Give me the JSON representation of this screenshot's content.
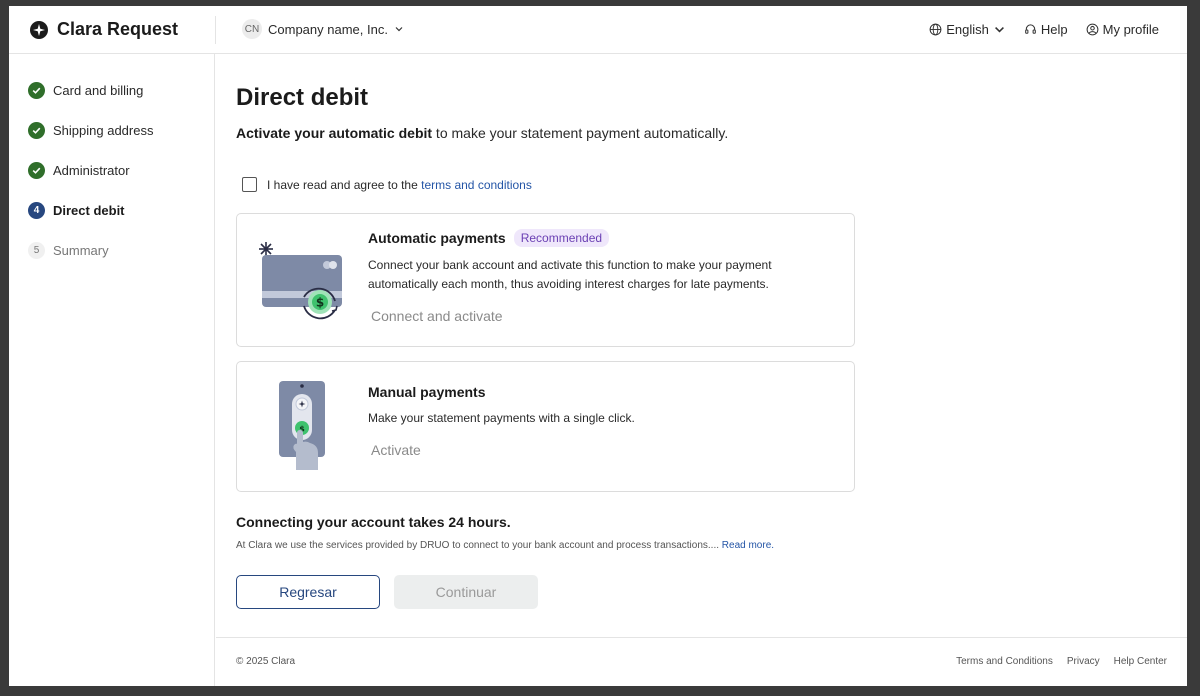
{
  "header": {
    "brand": "Clara Request",
    "company_initials": "CN",
    "company_name": "Company name, Inc.",
    "language": "English",
    "help": "Help",
    "profile": "My profile"
  },
  "sidebar": {
    "steps": [
      {
        "label": "Card and billing",
        "state": "done"
      },
      {
        "label": "Shipping address",
        "state": "done"
      },
      {
        "label": "Administrator",
        "state": "done"
      },
      {
        "label": "Direct debit",
        "state": "current",
        "number": "4"
      },
      {
        "label": "Summary",
        "state": "pending",
        "number": "5"
      }
    ]
  },
  "main": {
    "title": "Direct debit",
    "subtitle_bold": "Activate your automatic debit",
    "subtitle_rest": " to make your statement payment automatically.",
    "agree_text": "I have read and agree to the ",
    "agree_link": "terms and conditions",
    "auto_card": {
      "title": "Automatic payments",
      "badge": "Recommended",
      "description": "Connect your bank account and activate this function to make your payment automatically each month, thus avoiding interest charges for late payments.",
      "action": "Connect and activate"
    },
    "manual_card": {
      "title": "Manual payments",
      "description": "Make your statement payments with a single click.",
      "action": "Activate"
    },
    "note_title": "Connecting your account takes 24 hours.",
    "note_text": "At Clara we use the services provided by DRUO to connect to your bank account and process transactions.... ",
    "note_link": "Read more.",
    "back_button": "Regresar",
    "continue_button": "Continuar"
  },
  "footer": {
    "copyright": "© 2025 Clara",
    "links": [
      "Terms and Conditions",
      "Privacy",
      "Help Center"
    ]
  },
  "colors": {
    "primary": "#27477f",
    "success": "#2f6e2a",
    "link": "#2455a6",
    "badge_text": "#6a3fb3",
    "badge_bg": "#efe7fb"
  }
}
